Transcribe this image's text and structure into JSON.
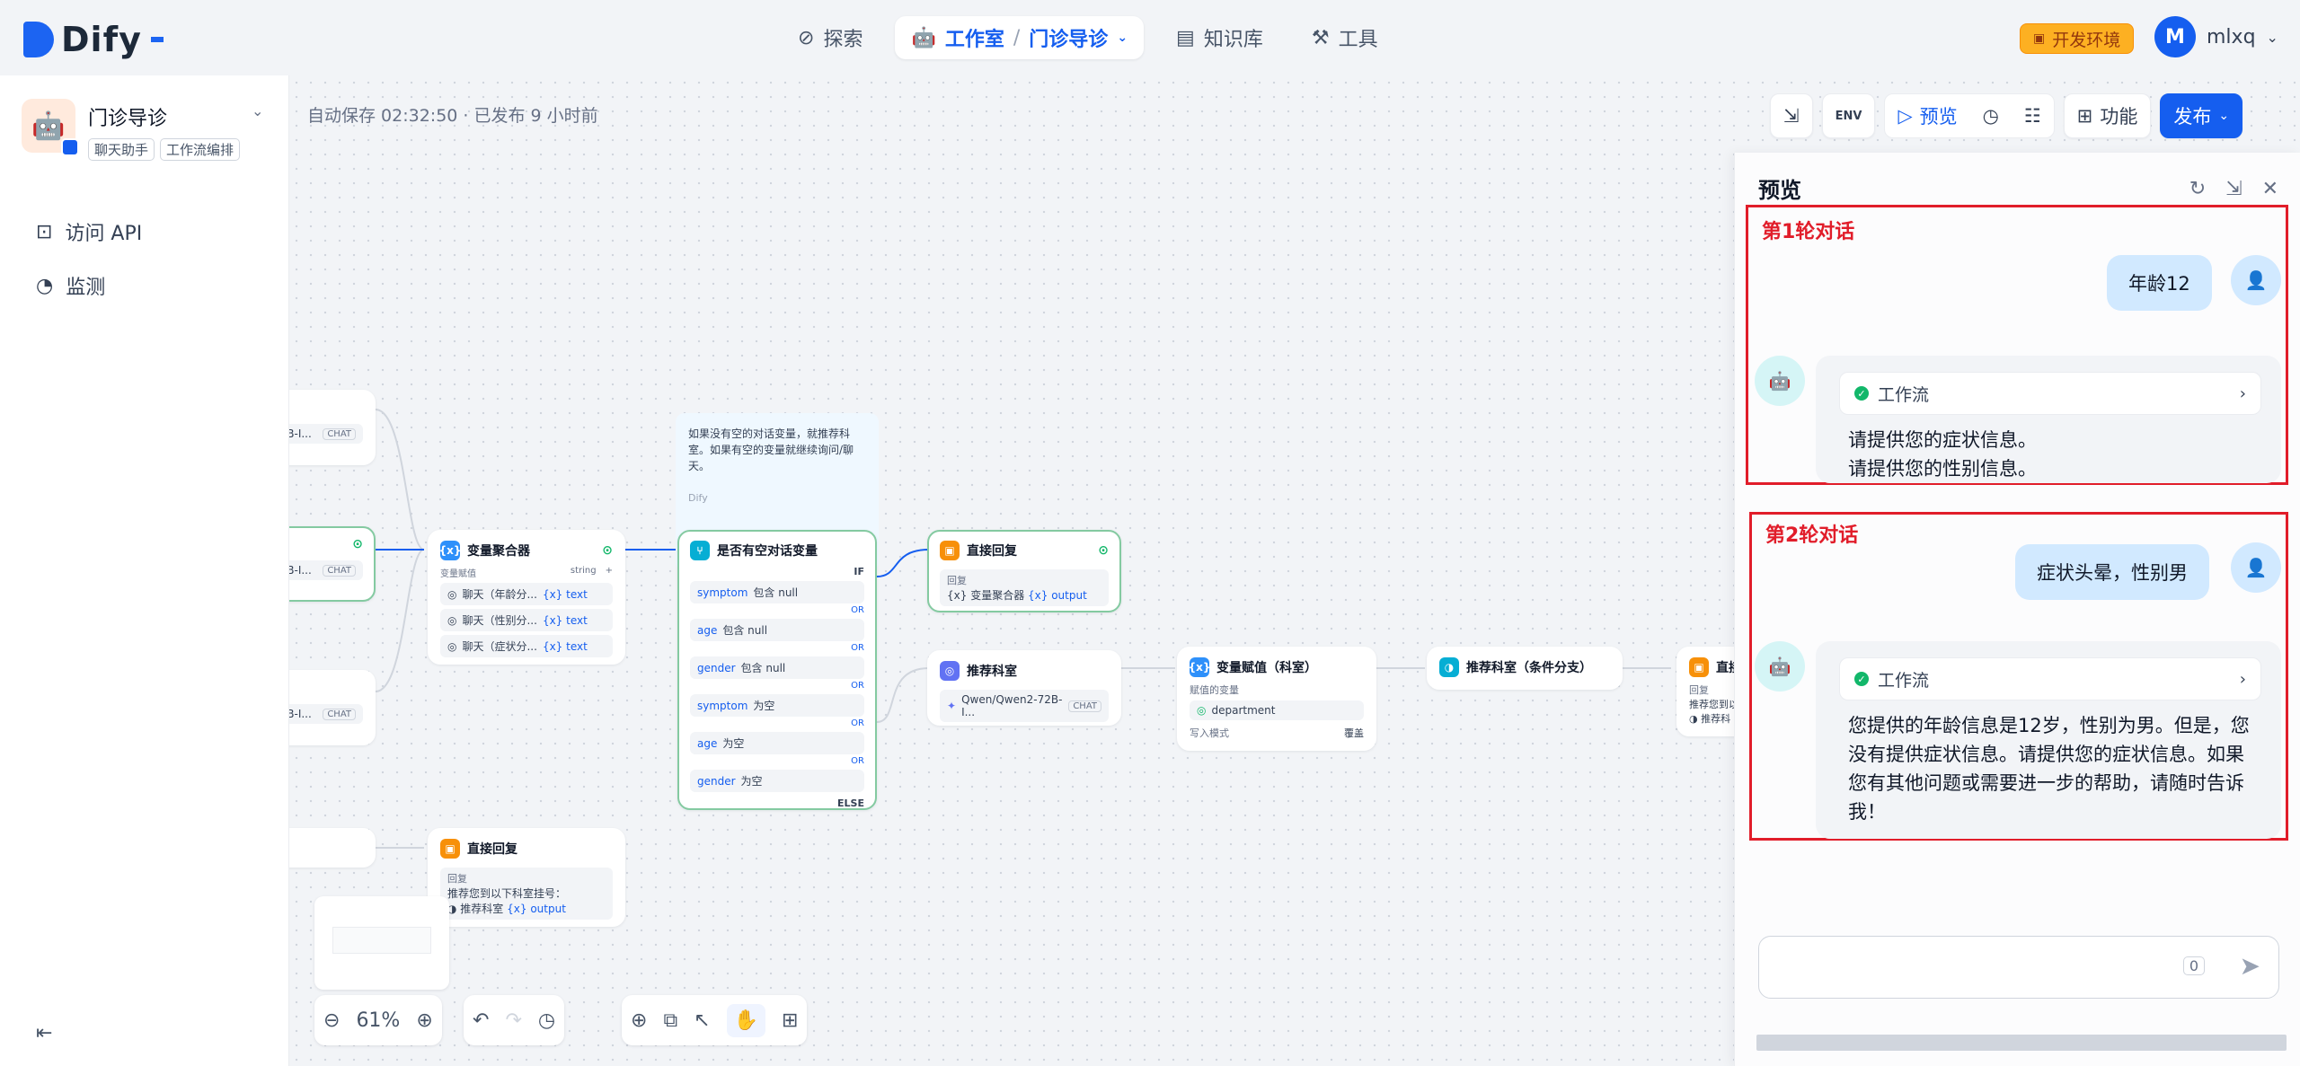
{
  "nav": {
    "brand": "Dify",
    "explore": "探索",
    "studio": "工作室",
    "app_crumb": "门诊导诊",
    "knowledge": "知识库",
    "tools": "工具",
    "env_badge": "开发环境",
    "user_initial": "M",
    "user_name": "mlxq"
  },
  "sidebar": {
    "app_name": "门诊导诊",
    "tags": [
      "聊天助手",
      "工作流编排"
    ],
    "items": [
      {
        "label": "访问 API",
        "icon": "terminal-icon"
      },
      {
        "label": "监测",
        "icon": "gauge-icon"
      }
    ]
  },
  "canvas": {
    "autosave": "自动保存 02:32:50 · 已发布 9 小时前",
    "toolbar": {
      "preview": "预览",
      "features": "功能",
      "publish": "发布"
    },
    "zoom": "61%",
    "note": {
      "text": "如果没有空的对话变量，就推荐科室。如果有空的变量就继续询问/聊天。",
      "author": "Dify"
    },
    "nodes": {
      "aggregator": {
        "title": "变量聚合器",
        "assign_label": "变量赋值",
        "type": "string",
        "rows": [
          {
            "text": "聊天（年龄分...",
            "var": "text"
          },
          {
            "text": "聊天（性别分...",
            "var": "text"
          },
          {
            "text": "聊天（症状分...",
            "var": "text"
          }
        ]
      },
      "ifelse": {
        "title": "是否有空对话变量",
        "if": "IF",
        "else": "ELSE",
        "or": "OR",
        "conds": [
          {
            "var": "symptom",
            "op": "包含 null"
          },
          {
            "var": "age",
            "op": "包含 null"
          },
          {
            "var": "gender",
            "op": "包含 null"
          },
          {
            "var": "symptom",
            "op": "为空"
          },
          {
            "var": "age",
            "op": "为空"
          },
          {
            "var": "gender",
            "op": "为空"
          }
        ]
      },
      "reply1": {
        "title": "直接回复",
        "label": "回复",
        "src": "变量聚合器",
        "var": "output"
      },
      "recommend": {
        "title": "推荐科室",
        "model": "Qwen/Qwen2-72B-I...",
        "mode": "CHAT"
      },
      "assign": {
        "title": "变量赋值（科室）",
        "label": "赋值的变量",
        "var": "department",
        "write_mode": "写入模式",
        "overwrite": "覆盖"
      },
      "branch": {
        "title": "推荐科室（条件分支）"
      },
      "reply_right": {
        "title": "直接",
        "label": "回复",
        "line": "推荐您到以",
        "ref": "推荐科"
      },
      "reply2": {
        "title": "直接回复",
        "label": "回复",
        "line": "推荐您到以下科室挂号：",
        "ref": "推荐科室",
        "var": "output"
      },
      "left_models": [
        {
          "model": "72B-I...",
          "mode": "CHAT"
        },
        {
          "model": "72B-I...",
          "mode": "CHAT"
        },
        {
          "model": "72B-I...",
          "mode": "CHAT"
        }
      ]
    }
  },
  "preview": {
    "title": "预览",
    "rounds": [
      {
        "label": "第1轮对话",
        "user": "年龄12",
        "workflow": "工作流",
        "bot_lines": [
          "请提供您的症状信息。",
          "请提供您的性别信息。"
        ]
      },
      {
        "label": "第2轮对话",
        "user": "症状头晕，性别男",
        "workflow": "工作流",
        "bot_lines": [
          "您提供的年龄信息是12岁，性别为男。但是，您",
          "没有提供症状信息。请提供您的症状信息。如果",
          "您有其他问题或需要进一步的帮助，请随时告诉",
          "我！"
        ]
      }
    ],
    "counter": "0"
  },
  "colors": {
    "accent": "#155eef",
    "annotation_red": "#e11d2a",
    "success": "#12b76a"
  }
}
